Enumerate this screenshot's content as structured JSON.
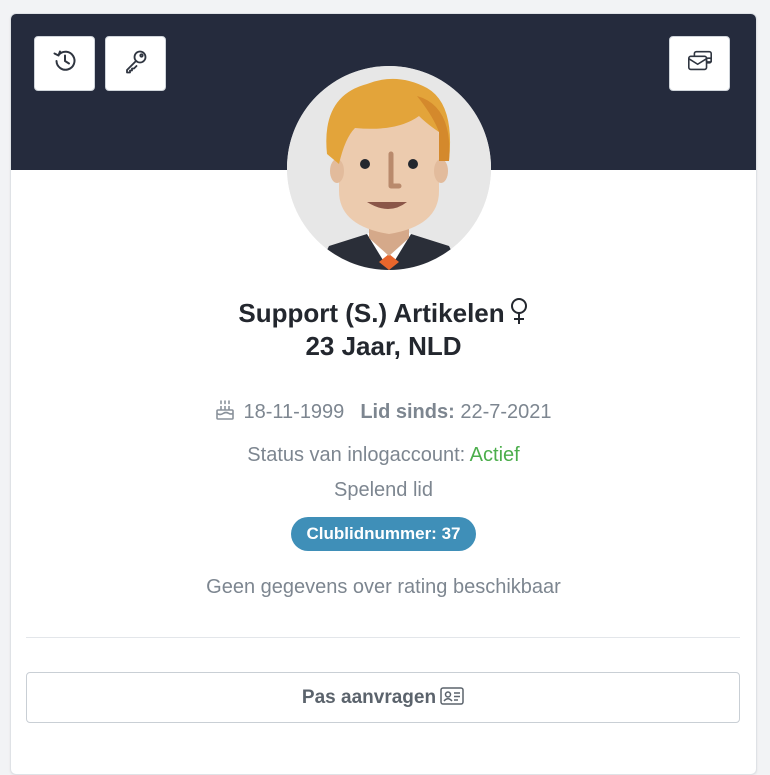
{
  "header": {
    "history_icon": "history-icon",
    "key_icon": "key-icon",
    "card_icon": "wallet-card-icon"
  },
  "profile": {
    "avatar": "avatar-male-icon",
    "name": "Support (S.) Artikelen",
    "gender_icon": "female-symbol-icon",
    "age_country": "23 Jaar, NLD",
    "birthdate": "18-11-1999",
    "member_since_label": "Lid sinds:",
    "member_since_value": "22-7-2021",
    "status_label": "Status van inlogaccount:",
    "status_value": "Actief",
    "role": "Spelend lid",
    "club_number_badge": "Clublidnummer: 37",
    "rating_text": "Geen gegevens over rating beschikbaar"
  },
  "actions": {
    "request_pass_label": "Pas aanvragen",
    "request_pass_icon": "id-card-icon"
  },
  "colors": {
    "header_bg": "#252b3d",
    "badge_bg": "#3f8fb8",
    "status_active": "#4cae4c",
    "muted_text": "#7d8690"
  }
}
